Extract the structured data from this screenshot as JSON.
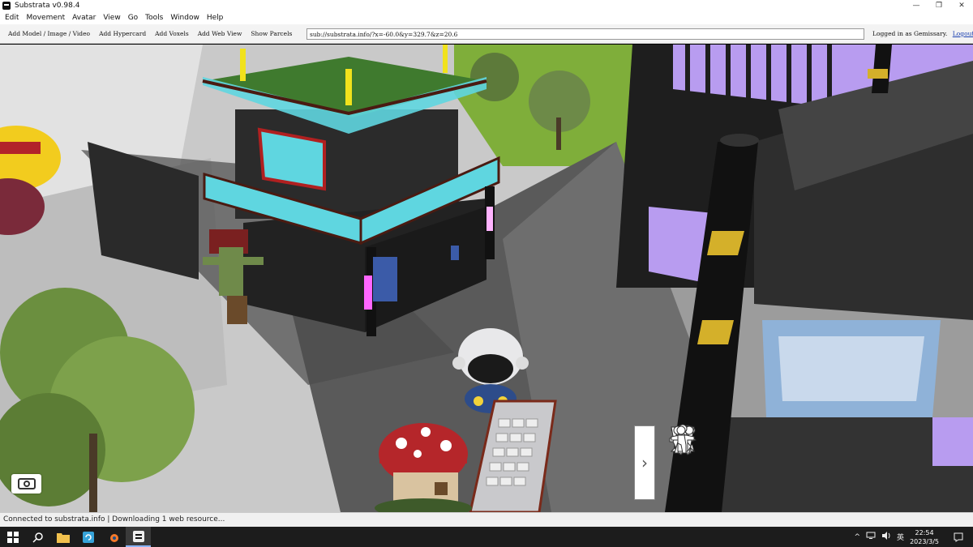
{
  "window": {
    "title": "Substrata v0.98.4",
    "minimize": "—",
    "restore": "❐",
    "close": "✕"
  },
  "menu": [
    "Edit",
    "Movement",
    "Avatar",
    "View",
    "Go",
    "Tools",
    "Window",
    "Help"
  ],
  "toolbar": {
    "buttons": [
      "Add Model / Image / Video",
      "Add Hypercard",
      "Add Voxels",
      "Add Web View",
      "Show Parcels"
    ],
    "url": "sub://substrata.info/?x=-60.0&y=329.7&z=20.6",
    "logged_in_prefix": "Logged in as",
    "username": "Gemissary.",
    "logout": "Logout"
  },
  "viewport": {
    "camera_icon": "camera-icon",
    "gesture_toggle": "›",
    "gestures": [
      "sit-gesture-icon",
      "think-gesture-icon",
      "sleep-gesture-icon",
      "run-gesture-icon",
      "dance-gesture-icon",
      "cheer-gesture-icon",
      "sit-chair-gesture-icon",
      "kneel-gesture-icon",
      "wave-gesture-icon",
      "shrug-gesture-icon",
      "crouch-gesture-icon",
      "bow-gesture-icon",
      "clap-gesture-icon",
      "lean-gesture-icon"
    ]
  },
  "status": "Connected to substrata.info | Downloading 1 web resource...",
  "taskbar": {
    "tray_chevron": "^",
    "ime": "英",
    "time": "22:54",
    "date": "2023/3/5"
  },
  "colors": {
    "accent_cyan": "#5fd6e0",
    "frame_red": "#7a2a1a",
    "gold": "#d4b02a",
    "purple": "#b89cf0"
  }
}
